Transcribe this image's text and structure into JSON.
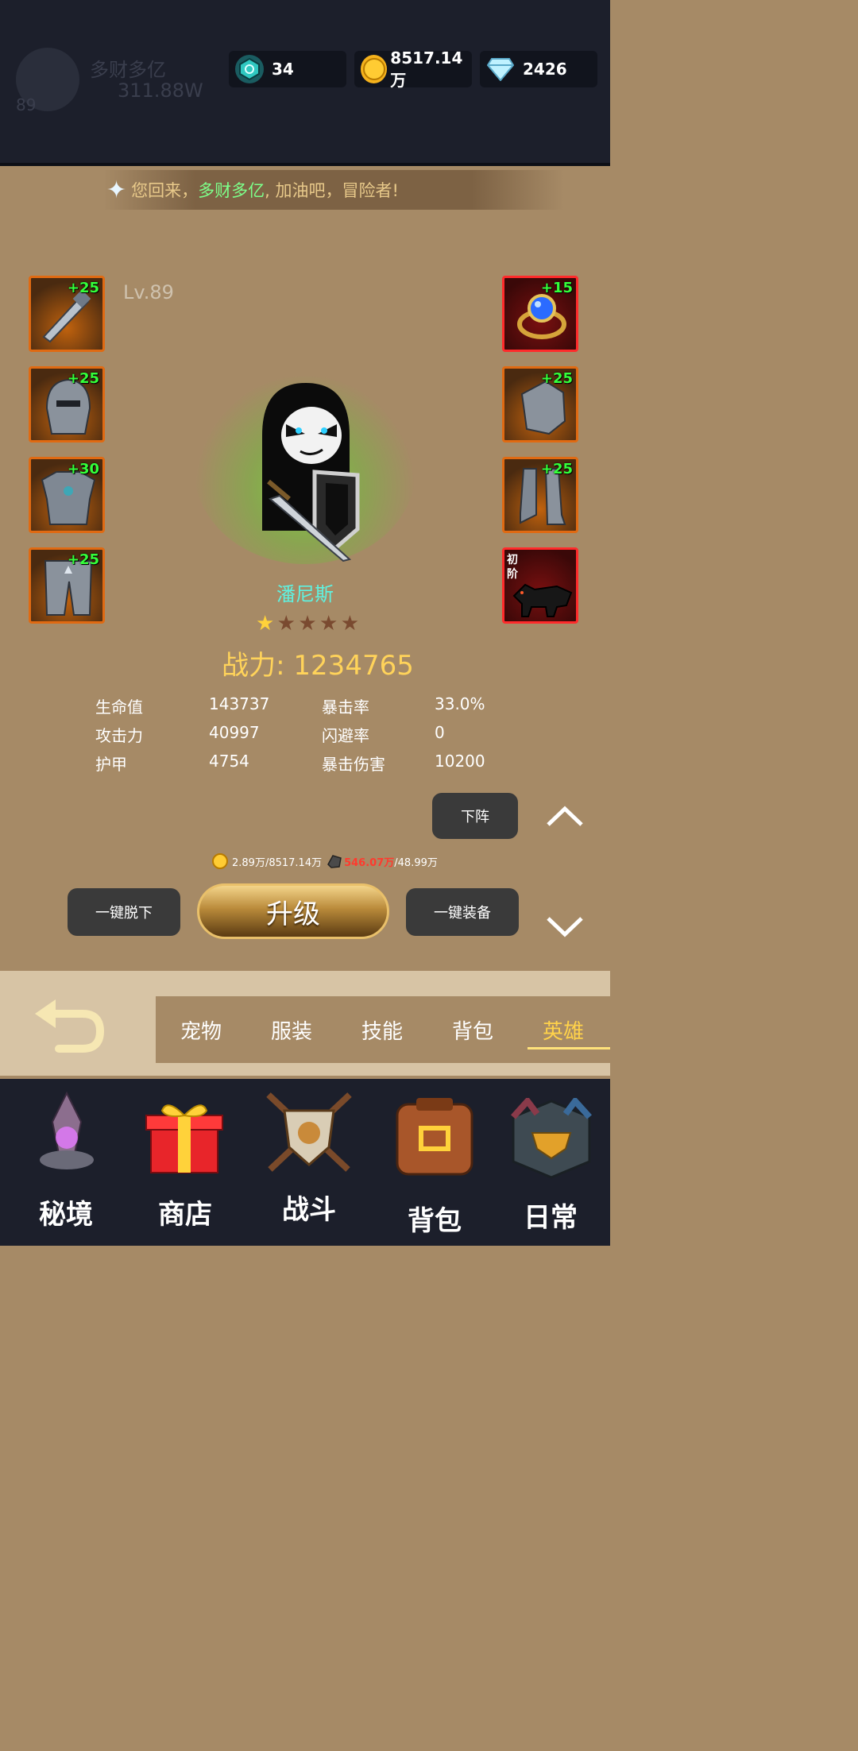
{
  "header": {
    "ghost_name": "多财多亿",
    "ghost_power": "311.88W",
    "ghost_level": "89",
    "resources": [
      {
        "icon": "rune-gem-icon",
        "value": "34",
        "color": "#2fc7c0"
      },
      {
        "icon": "gold-coin-icon",
        "value": "8517.14万",
        "color": "#f5b21c"
      },
      {
        "icon": "diamond-icon",
        "value": "2426",
        "color": "#9fe8ff"
      }
    ]
  },
  "banner": {
    "prefix": "您回来，",
    "name": "多财多亿",
    "suffix": ", 加油吧，冒险者!"
  },
  "hero": {
    "level": "Lv.89",
    "name": "潘尼斯",
    "stars_filled": 1,
    "stars_total": 5,
    "power_label": "战力: 1234765"
  },
  "equipment_left": [
    {
      "name": "weapon",
      "plus": "+25"
    },
    {
      "name": "helmet",
      "plus": "+25"
    },
    {
      "name": "chest-armor",
      "plus": "+30"
    },
    {
      "name": "leg-armor",
      "plus": "+25"
    }
  ],
  "equipment_right": [
    {
      "name": "ring",
      "plus": "+15"
    },
    {
      "name": "gauntlet",
      "plus": "+25"
    },
    {
      "name": "boots",
      "plus": "+25"
    },
    {
      "name": "mount",
      "stage": "初阶"
    }
  ],
  "stats": [
    {
      "label": "生命值",
      "value": "143737",
      "label2": "暴击率",
      "value2": "33.0%"
    },
    {
      "label": "攻击力",
      "value": "40997",
      "label2": "闪避率",
      "value2": "0"
    },
    {
      "label": "护甲",
      "value": "4754",
      "label2": "暴击伤害",
      "value2": "10200"
    }
  ],
  "actions": {
    "unassign": "下阵",
    "unequip_all": "一键脱下",
    "upgrade": "升级",
    "equip_all": "一键装备"
  },
  "cost": {
    "gold": "2.89万/8517.14万",
    "material_have": "546.07万",
    "material_need": "/48.99万"
  },
  "tabs": [
    {
      "label": "宠物",
      "active": false
    },
    {
      "label": "服装",
      "active": false
    },
    {
      "label": "技能",
      "active": false
    },
    {
      "label": "背包",
      "active": false
    },
    {
      "label": "英雄",
      "active": true
    }
  ],
  "bottom_nav": [
    {
      "label": "秘境",
      "icon": "crystal-realm-icon"
    },
    {
      "label": "商店",
      "icon": "gift-box-icon"
    },
    {
      "label": "战斗",
      "icon": "battle-crest-icon"
    },
    {
      "label": "背包",
      "icon": "backpack-icon"
    },
    {
      "label": "日常",
      "icon": "daily-helmet-icon"
    }
  ]
}
